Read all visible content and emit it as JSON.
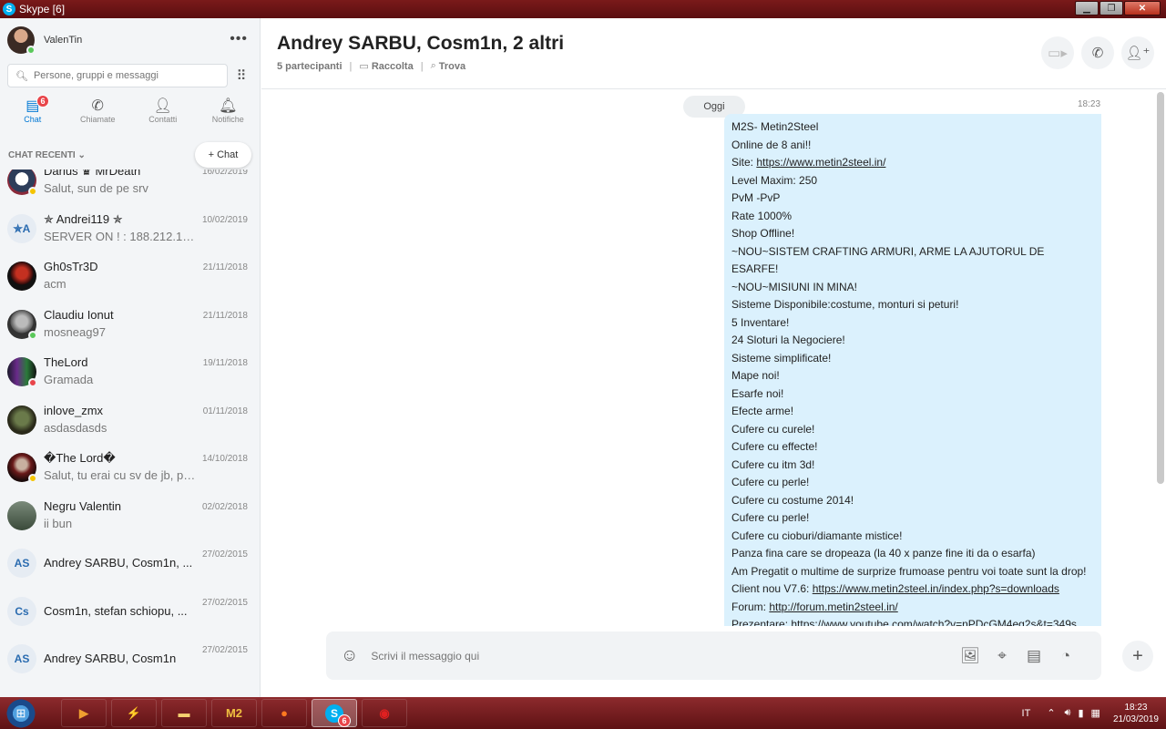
{
  "window": {
    "title": "Skype [6]"
  },
  "user": {
    "name": "ValenTin"
  },
  "search": {
    "placeholder": "Persone, gruppi e messaggi"
  },
  "nav": {
    "tabs": [
      {
        "label": "Chat",
        "badge": "6"
      },
      {
        "label": "Chiamate"
      },
      {
        "label": "Contatti"
      },
      {
        "label": "Notifiche"
      }
    ]
  },
  "recent": {
    "label": "CHAT RECENTI",
    "new_chat_label": "Chat"
  },
  "chats": [
    {
      "name": "Darius ♛ MrDeath",
      "preview": "Salut, sun de pe srv",
      "date": "16/02/2019"
    },
    {
      "name": "✯ Andrei119 ✯",
      "preview": "SERVER ON ! : 188.212.100....",
      "date": "10/02/2019",
      "initials": "✯A"
    },
    {
      "name": "Gh0sTr3D",
      "preview": "acm",
      "date": "21/11/2018"
    },
    {
      "name": "Claudiu Ionut",
      "preview": "mosneag97",
      "date": "21/11/2018"
    },
    {
      "name": "TheLord",
      "preview": "Gramada",
      "date": "19/11/2018"
    },
    {
      "name": "inlove_zmx",
      "preview": "asdasdasds",
      "date": "01/11/2018"
    },
    {
      "name": "�The Lord�",
      "preview": "Salut, tu erai cu sv de jb, pa...",
      "date": "14/10/2018"
    },
    {
      "name": "Negru Valentin",
      "preview": "ii bun",
      "date": "02/02/2018"
    },
    {
      "name": "Andrey SARBU, Cosm1n, ...",
      "preview": "",
      "date": "27/02/2015",
      "initials": "AS"
    },
    {
      "name": "Cosm1n, stefan schiopu, ...",
      "preview": "",
      "date": "27/02/2015",
      "initials": "Cs"
    },
    {
      "name": "Andrey SARBU, Cosm1n",
      "preview": "",
      "date": "27/02/2015",
      "initials": "AS"
    }
  ],
  "conversation": {
    "title": "Andrey SARBU, Cosm1n, 2 altri",
    "participants": "5 partecipanti",
    "gallery": "Raccolta",
    "find": "Trova",
    "day": "Oggi",
    "time": "18:23",
    "message": [
      {
        "text": "M2S- Metin2Steel"
      },
      {
        "text": "Online de 8 ani!!"
      },
      {
        "text": "Site: ",
        "link": "https://www.metin2steel.in/"
      },
      {
        "text": "Level Maxim: 250"
      },
      {
        "text": "PvM -PvP"
      },
      {
        "text": "Rate 1000%"
      },
      {
        "text": "Shop Offline!"
      },
      {
        "text": "~NOU~SISTEM CRAFTING ARMURI, ARME LA AJUTORUL DE ESARFE!"
      },
      {
        "text": "~NOU~MISIUNI IN MINA!"
      },
      {
        "text": "Sisteme Disponibile:costume, monturi si peturi!"
      },
      {
        "text": "5 Inventare!"
      },
      {
        "text": "24 Sloturi la Negociere!"
      },
      {
        "text": "Sisteme simplificate!"
      },
      {
        "text": "Mape noi!"
      },
      {
        "text": "Esarfe noi!"
      },
      {
        "text": "Efecte arme!"
      },
      {
        "text": "Cufere cu curele!"
      },
      {
        "text": "Cufere cu effecte!"
      },
      {
        "text": "Cufere cu itm 3d!"
      },
      {
        "text": "Cufere cu perle!"
      },
      {
        "text": "Cufere cu costume 2014!"
      },
      {
        "text": "Cufere cu perle!"
      },
      {
        "text": "Cufere cu cioburi/diamante mistice!"
      },
      {
        "text": "Panza fina care se dropeaza (la 40 x panze fine iti da o esarfa)"
      },
      {
        "text": "Am Pregatit o multime de surprize frumoase pentru voi toate sunt la drop!"
      },
      {
        "text": "Client nou V7.6: ",
        "link": "https://www.metin2steel.in/index.php?s=downloads"
      },
      {
        "text": "Forum: ",
        "link": "http://forum.metin2steel.in/"
      },
      {
        "text": "Prezentare: ",
        "link": "https://www.youtube.com/watch?v=nPDcGM4eg2s&t=349s"
      }
    ]
  },
  "composer": {
    "placeholder": "Scrivi il messaggio qui"
  },
  "taskbar": {
    "apps": [
      {
        "name": "media-player",
        "label": ""
      },
      {
        "name": "app-2",
        "label": ""
      },
      {
        "name": "explorer",
        "label": ""
      },
      {
        "name": "metin2",
        "label": "M2"
      },
      {
        "name": "firefox",
        "label": ""
      },
      {
        "name": "skype",
        "label": "",
        "badge": "6"
      },
      {
        "name": "recorder",
        "label": ""
      }
    ],
    "lang": "IT",
    "time": "18:23",
    "date": "21/03/2019"
  }
}
